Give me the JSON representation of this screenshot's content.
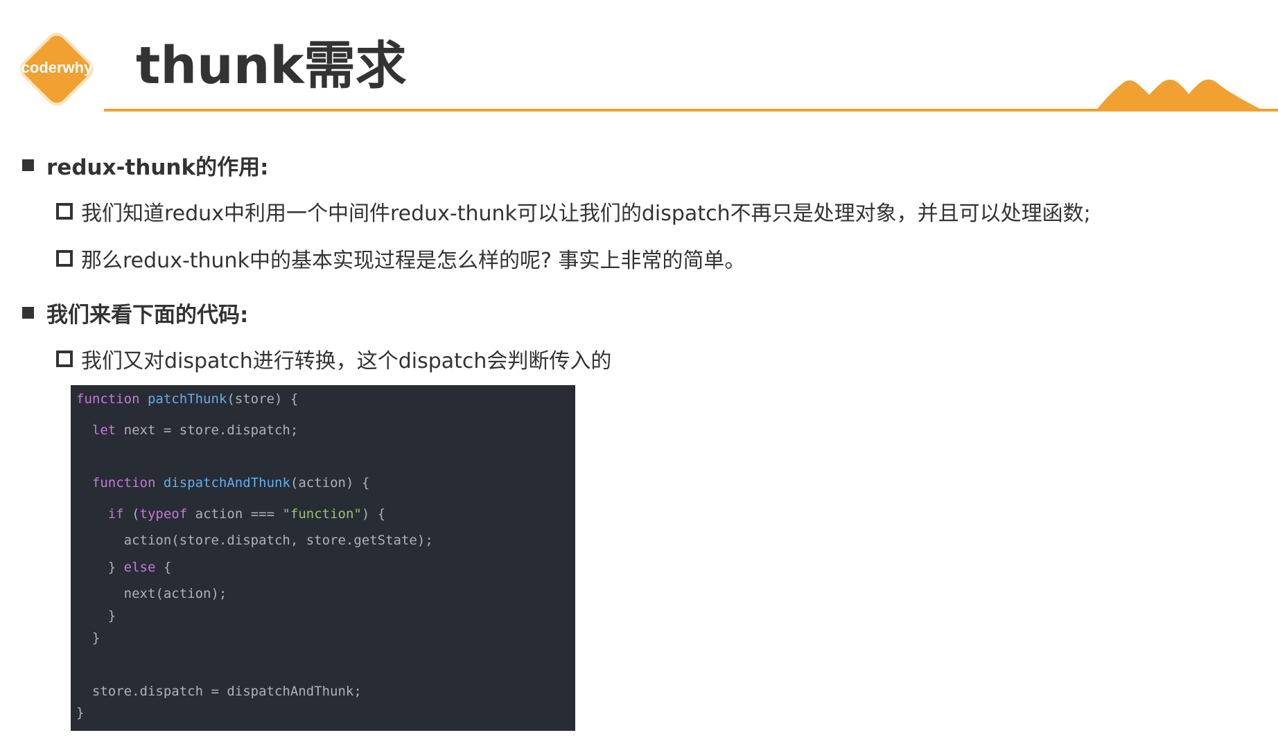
{
  "logo": {
    "text": "coderwhy"
  },
  "title": "thunk需求",
  "colors": {
    "accent": "#f0a132",
    "text": "#333333",
    "code_bg": "#282c34",
    "code_keyword": "#c678dd",
    "code_function": "#61afef",
    "code_string": "#98c379",
    "code_plain": "#abb2bf"
  },
  "sections": [
    {
      "heading": "redux-thunk的作用:",
      "items": [
        "我们知道redux中利用一个中间件redux-thunk可以让我们的dispatch不再只是处理对象，并且可以处理函数;",
        "那么redux-thunk中的基本实现过程是怎么样的呢? 事实上非常的简单。"
      ]
    },
    {
      "heading": "我们来看下面的代码:",
      "items": [
        "我们又对dispatch进行转换，这个dispatch会判断传入的"
      ]
    }
  ],
  "code": {
    "lines": [
      [
        [
          "kw",
          "function"
        ],
        [
          "plain",
          " "
        ],
        [
          "fn",
          "patchThunk"
        ],
        [
          "plain",
          "(store) {"
        ]
      ],
      [
        [
          "plain",
          "  "
        ],
        [
          "kw",
          "let"
        ],
        [
          "plain",
          " next = store.dispatch;"
        ]
      ],
      [
        [
          "plain",
          "  "
        ],
        [
          "kw",
          "function"
        ],
        [
          "plain",
          " "
        ],
        [
          "fn",
          "dispatchAndThunk"
        ],
        [
          "plain",
          "(action) {"
        ]
      ],
      [
        [
          "plain",
          "    "
        ],
        [
          "kw",
          "if"
        ],
        [
          "plain",
          " ("
        ],
        [
          "kw",
          "typeof"
        ],
        [
          "plain",
          " action === "
        ],
        [
          "str",
          "\"function\""
        ],
        [
          "plain",
          ") {"
        ]
      ],
      [
        [
          "plain",
          "      action(store.dispatch, store.getState);"
        ]
      ],
      [
        [
          "plain",
          "    } "
        ],
        [
          "kw",
          "else"
        ],
        [
          "plain",
          " {"
        ]
      ],
      [
        [
          "plain",
          "      next(action);"
        ]
      ],
      [
        [
          "plain",
          "    }"
        ]
      ],
      [
        [
          "plain",
          "  }"
        ]
      ],
      [
        [
          "plain",
          "  store.dispatch = dispatchAndThunk;"
        ]
      ],
      [
        [
          "plain",
          "}"
        ]
      ]
    ]
  }
}
